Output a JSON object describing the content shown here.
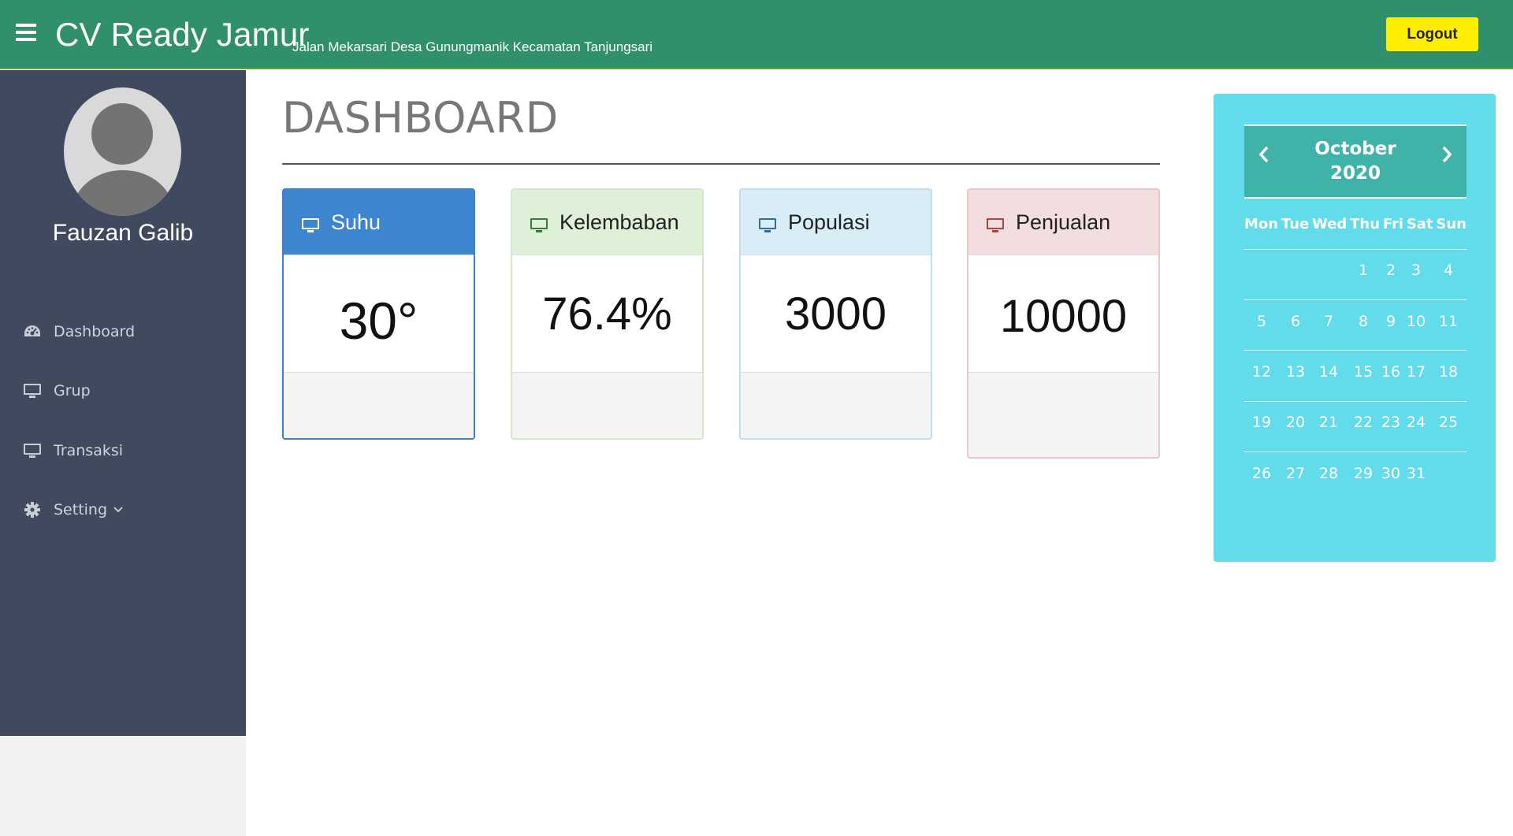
{
  "header": {
    "brand": "CV Ready Jamur",
    "subtitle": "Jalan Mekarsari Desa Gunungmanik Kecamatan Tanjungsari",
    "logout_label": "Logout",
    "menu_icon": "hamburger-icon"
  },
  "sidebar": {
    "username": "Fauzan Galib",
    "items": [
      {
        "label": "Dashboard",
        "icon": "dashboard-icon"
      },
      {
        "label": "Grup",
        "icon": "monitor-icon"
      },
      {
        "label": "Transaksi",
        "icon": "monitor-icon"
      },
      {
        "label": "Setting",
        "icon": "gear-icon"
      }
    ]
  },
  "main": {
    "title": "DASHBOARD",
    "cards": [
      {
        "label": "Suhu",
        "value": "30°",
        "color": "#3d86cf"
      },
      {
        "label": "Kelembaban",
        "value": "76.4%",
        "color": "#dff0d8"
      },
      {
        "label": "Populasi",
        "value": "3000",
        "color": "#d9edf7"
      },
      {
        "label": "Penjualan",
        "value": "10000",
        "color": "#f2dede"
      }
    ]
  },
  "calendar": {
    "month": "October",
    "year": "2020",
    "weekdays": [
      "Mon",
      "Tue",
      "Wed",
      "Thu",
      "Fri",
      "Sat",
      "Sun"
    ],
    "weeks": [
      [
        "",
        "",
        "",
        "1",
        "2",
        "3",
        "4"
      ],
      [
        "5",
        "6",
        "7",
        "8",
        "9",
        "10",
        "11"
      ],
      [
        "12",
        "13",
        "14",
        "15",
        "16",
        "17",
        "18"
      ],
      [
        "19",
        "20",
        "21",
        "22",
        "23",
        "24",
        "25"
      ],
      [
        "26",
        "27",
        "28",
        "29",
        "30",
        "31",
        ""
      ]
    ]
  },
  "colors": {
    "topbar": "#31906c",
    "sidebar": "#404a5f",
    "logout": "#ffee00",
    "calendar_panel": "#62dbea",
    "calendar_header": "#3fb3a7"
  }
}
